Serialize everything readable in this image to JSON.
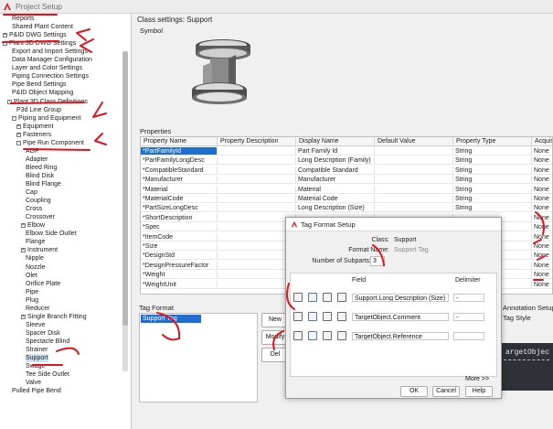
{
  "window": {
    "title": "Project Setup"
  },
  "tree": {
    "items": [
      {
        "label": "Reports",
        "indent": 2,
        "toggle": ""
      },
      {
        "label": "Shared Plant Content",
        "indent": 2,
        "toggle": ""
      },
      {
        "label": "P&ID DWG Settings",
        "indent": 0,
        "toggle": "+"
      },
      {
        "label": "Plant 3D DWG Settings",
        "indent": 0,
        "toggle": "-"
      },
      {
        "label": "Export and Import Settings",
        "indent": 2,
        "toggle": ""
      },
      {
        "label": "Data Manager Configuration",
        "indent": 2,
        "toggle": ""
      },
      {
        "label": "Layer and Color Settings",
        "indent": 2,
        "toggle": ""
      },
      {
        "label": "Piping Connection Settings",
        "indent": 2,
        "toggle": ""
      },
      {
        "label": "Pipe Bend Settings",
        "indent": 2,
        "toggle": ""
      },
      {
        "label": "P&ID Object Mapping",
        "indent": 2,
        "toggle": ""
      },
      {
        "label": "Plant 3D Class Definitions",
        "indent": 1,
        "toggle": "-"
      },
      {
        "label": "P3d Line Group",
        "indent": 3,
        "toggle": ""
      },
      {
        "label": "Piping and Equipment",
        "indent": 2,
        "toggle": "-"
      },
      {
        "label": "Equipment",
        "indent": 3,
        "toggle": "+"
      },
      {
        "label": "Fasteners",
        "indent": 3,
        "toggle": "+"
      },
      {
        "label": "Pipe Run Component",
        "indent": 3,
        "toggle": "-"
      },
      {
        "label": "AGP",
        "indent": 5,
        "toggle": ""
      },
      {
        "label": "Adapter",
        "indent": 5,
        "toggle": ""
      },
      {
        "label": "Bleed Ring",
        "indent": 5,
        "toggle": ""
      },
      {
        "label": "Blind Disk",
        "indent": 5,
        "toggle": ""
      },
      {
        "label": "Blind Flange",
        "indent": 5,
        "toggle": ""
      },
      {
        "label": "Cap",
        "indent": 5,
        "toggle": ""
      },
      {
        "label": "Coupling",
        "indent": 5,
        "toggle": ""
      },
      {
        "label": "Cross",
        "indent": 5,
        "toggle": ""
      },
      {
        "label": "Crossover",
        "indent": 5,
        "toggle": ""
      },
      {
        "label": "Elbow",
        "indent": 4,
        "toggle": "+"
      },
      {
        "label": "Elbow Side Outlet",
        "indent": 5,
        "toggle": ""
      },
      {
        "label": "Flange",
        "indent": 5,
        "toggle": ""
      },
      {
        "label": "Instrument",
        "indent": 4,
        "toggle": "+"
      },
      {
        "label": "Nipple",
        "indent": 5,
        "toggle": ""
      },
      {
        "label": "Nozzle",
        "indent": 5,
        "toggle": ""
      },
      {
        "label": "Olet",
        "indent": 5,
        "toggle": ""
      },
      {
        "label": "Orifice Plate",
        "indent": 5,
        "toggle": ""
      },
      {
        "label": "Pipe",
        "indent": 5,
        "toggle": ""
      },
      {
        "label": "Plug",
        "indent": 5,
        "toggle": ""
      },
      {
        "label": "Reducer",
        "indent": 5,
        "toggle": ""
      },
      {
        "label": "Single Branch Fitting",
        "indent": 4,
        "toggle": "+"
      },
      {
        "label": "Sleeve",
        "indent": 5,
        "toggle": ""
      },
      {
        "label": "Spacer Disk",
        "indent": 5,
        "toggle": ""
      },
      {
        "label": "Spectacle Blind",
        "indent": 5,
        "toggle": ""
      },
      {
        "label": "Strainer",
        "indent": 5,
        "toggle": ""
      },
      {
        "label": "Support",
        "indent": 5,
        "toggle": "",
        "selected": true
      },
      {
        "label": "Swage",
        "indent": 5,
        "toggle": ""
      },
      {
        "label": "Tee Side Outlet",
        "indent": 5,
        "toggle": ""
      },
      {
        "label": "Valve",
        "indent": 5,
        "toggle": ""
      },
      {
        "label": "Pulled Pipe Bend",
        "indent": 2,
        "toggle": ""
      }
    ]
  },
  "class_settings": {
    "title": "Class settings: Support",
    "symbol_label": "Symbol",
    "properties_label": "Properties"
  },
  "properties": {
    "columns": [
      "Property Name",
      "Property Description",
      "Display Name",
      "Default Value",
      "Property Type",
      "Acquis"
    ],
    "rows": [
      [
        "*PartFamilyId",
        "",
        "Part Family Id",
        "",
        "String",
        "None"
      ],
      [
        "*PartFamilyLongDesc",
        "",
        "Long Description (Family)",
        "",
        "String",
        "None"
      ],
      [
        "*CompatibleStandard",
        "",
        "Compatible Standard",
        "",
        "String",
        "None"
      ],
      [
        "*Manufacturer",
        "",
        "Manufacturer",
        "",
        "String",
        "None"
      ],
      [
        "*Material",
        "",
        "Material",
        "",
        "String",
        "None"
      ],
      [
        "*MaterialCode",
        "",
        "Material Code",
        "",
        "String",
        "None"
      ],
      [
        "*PartSizeLongDesc",
        "",
        "Long Description (Size)",
        "",
        "String",
        "None"
      ],
      [
        "*ShortDescription",
        "",
        "",
        "",
        "",
        "None"
      ],
      [
        "*Spec",
        "",
        "",
        "",
        "",
        "None"
      ],
      [
        "*ItemCode",
        "",
        "",
        "",
        "",
        "None"
      ],
      [
        "*Size",
        "",
        "",
        "",
        "",
        "None"
      ],
      [
        "*DesignStd",
        "",
        "",
        "",
        "",
        "None"
      ],
      [
        "*DesignPressureFactor",
        "",
        "",
        "",
        "",
        "None"
      ],
      [
        "*Weight",
        "",
        "",
        "",
        "",
        "None"
      ],
      [
        "*WeightUnit",
        "",
        "",
        "",
        "",
        "None"
      ]
    ]
  },
  "tag_format": {
    "label": "Tag Format",
    "items": [
      "Support Tag"
    ],
    "buttons": {
      "new": "New",
      "modify": "Modify",
      "delete": "Del"
    }
  },
  "annotation": {
    "title": "Annotation Setup",
    "tag_style": "Tag Style",
    "preview_text": "argetObjec"
  },
  "dialog": {
    "title": "Tag Format Setup",
    "class_label": "Class:",
    "class_value": "Support",
    "format_name_label": "Format Name:",
    "format_name_value": "Support Tag",
    "subparts_label": "Number of Subparts:",
    "subparts_value": "3",
    "field_header": "Field",
    "delimiter_header": "Delimiter",
    "rows": [
      {
        "field": "Support.Long Description (Size)",
        "delimiter": "-"
      },
      {
        "field": "TargetObject.Comment",
        "delimiter": "-"
      },
      {
        "field": "TargetObject.Reference",
        "delimiter": ""
      }
    ],
    "more_label": "More >>",
    "ok_label": "OK",
    "cancel_label": "Cancel",
    "help_label": "Help"
  },
  "colors": {
    "accent": "#1d6ed0",
    "annotation_red": "#e0141e",
    "logo_red": "#d01f26"
  }
}
